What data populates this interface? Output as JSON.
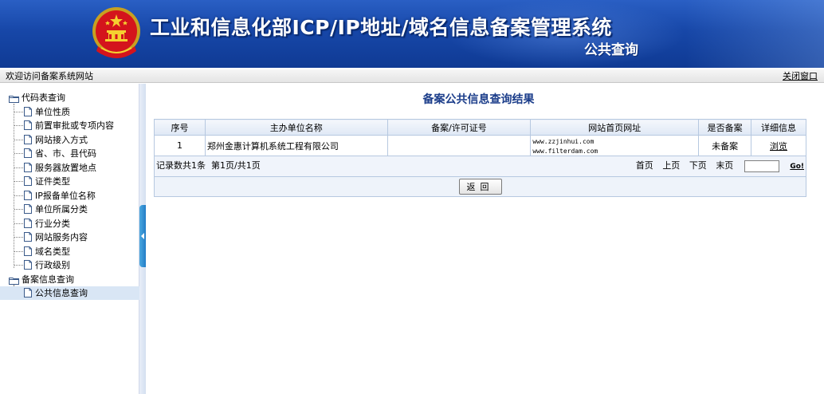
{
  "banner": {
    "title": "工业和信息化部ICP/IP地址/域名信息备案管理系统",
    "subtitle": "公共查询"
  },
  "topbar": {
    "welcome": "欢迎访问备案系统网站",
    "close": "关闭窗口"
  },
  "sidebar": {
    "groups": [
      {
        "label": "代码表查询",
        "items": [
          "单位性质",
          "前置审批或专项内容",
          "网站接入方式",
          "省、市、县代码",
          "服务器放置地点",
          "证件类型",
          "IP报备单位名称",
          "单位所属分类",
          "行业分类",
          "网站服务内容",
          "域名类型",
          "行政级别"
        ]
      },
      {
        "label": "备案信息查询",
        "items": [
          "公共信息查询"
        ]
      }
    ]
  },
  "main": {
    "title": "备案公共信息查询结果",
    "columns": [
      "序号",
      "主办单位名称",
      "备案/许可证号",
      "网站首页网址",
      "是否备案",
      "详细信息"
    ],
    "rows": [
      {
        "index": "1",
        "org": "郑州金惠计算机系统工程有限公司",
        "license": "",
        "urls": [
          "www.zzjinhui.com",
          "www.filterdam.com"
        ],
        "status": "未备案",
        "detail": "浏览"
      }
    ],
    "record_info": "记录数共1条  第1页/共1页",
    "pager": {
      "first": "首页",
      "prev": "上页",
      "next": "下页",
      "last": "末页",
      "go": "Go!"
    },
    "back_button": "返回"
  },
  "colors": {
    "banner": "#1747a8",
    "title": "#1b3d8a",
    "table_border": "#b6c8e0",
    "selected": "#d9e6f5"
  }
}
